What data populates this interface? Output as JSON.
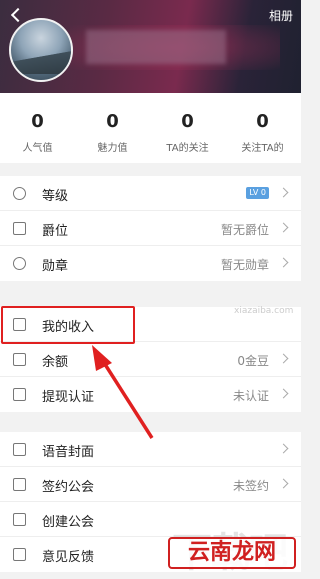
{
  "header": {
    "back_icon": "chevron-left-icon",
    "album_label": "相册"
  },
  "stats": [
    {
      "value": "0",
      "label": "人气值"
    },
    {
      "value": "0",
      "label": "魅力值"
    },
    {
      "value": "0",
      "label": "TA的关注"
    },
    {
      "value": "0",
      "label": "关注TA的"
    }
  ],
  "menu": {
    "level": {
      "label": "等级",
      "badge": "LV 0"
    },
    "title": {
      "label": "爵位",
      "value": "暂无爵位"
    },
    "medal": {
      "label": "勋章",
      "value": "暂无勋章"
    },
    "income": {
      "label": "我的收入"
    },
    "balance": {
      "label": "余额",
      "value": "0金豆"
    },
    "withdraw": {
      "label": "提现认证",
      "value": "未认证"
    },
    "voice_cover": {
      "label": "语音封面"
    },
    "sign_guild": {
      "label": "签约公会",
      "value": "未签约"
    },
    "create_guild": {
      "label": "创建公会"
    },
    "feedback": {
      "label": "意见反馈"
    }
  },
  "watermark": {
    "site": "xiazaiba.com",
    "big": "下载吧",
    "logo": "云南龙网"
  },
  "colors": {
    "highlight": "#e02020",
    "badge": "#5aa0e0",
    "header": "#5a2a44"
  }
}
